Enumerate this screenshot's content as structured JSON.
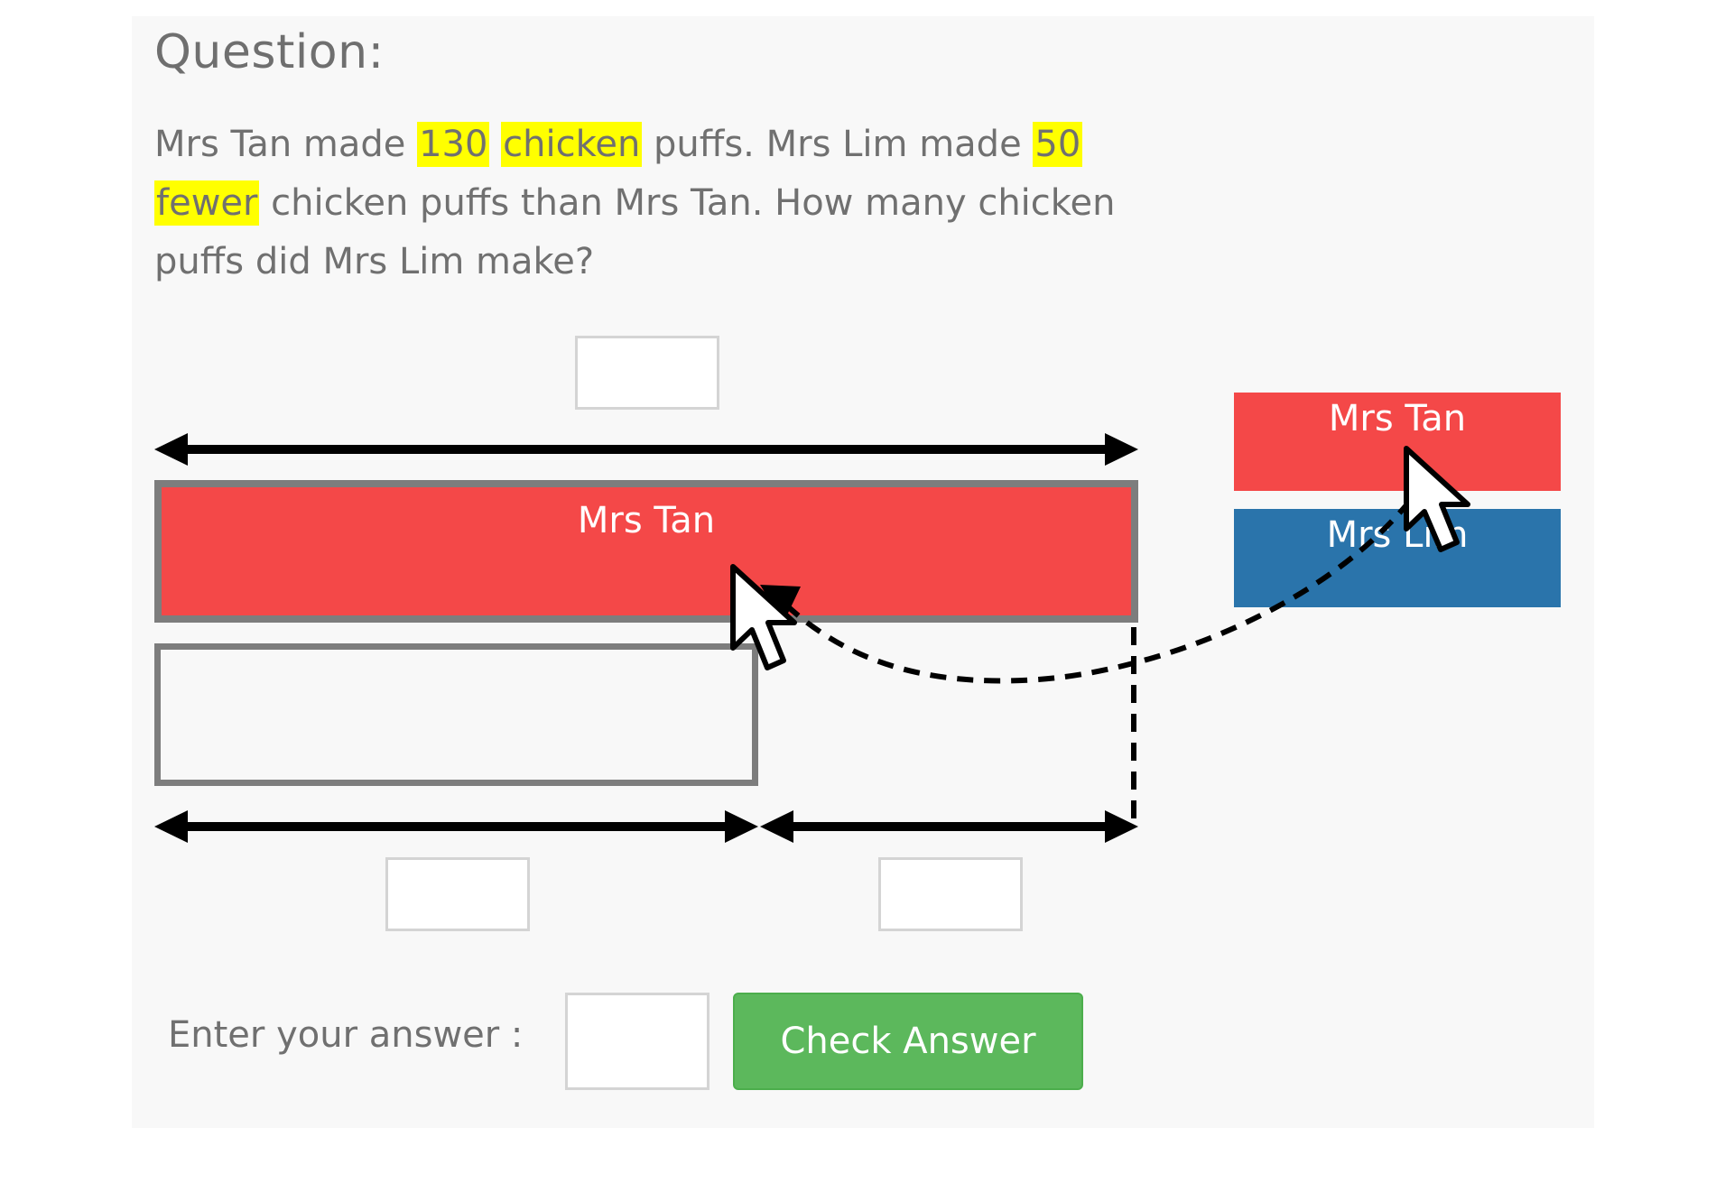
{
  "question": {
    "heading": "Question:",
    "parts": [
      {
        "text": "Mrs Tan made ",
        "highlight": false
      },
      {
        "text": "130",
        "highlight": true
      },
      {
        "text": " ",
        "highlight": false
      },
      {
        "text": "chicken",
        "highlight": true
      },
      {
        "text": " puffs. Mrs Lim made ",
        "highlight": false
      },
      {
        "text": "50",
        "highlight": true
      },
      {
        "text": " ",
        "highlight": false
      },
      {
        "text": "fewer",
        "highlight": true
      },
      {
        "text": " chicken puffs than Mrs Tan. How many chicken puffs did Mrs Lim make?",
        "highlight": false
      }
    ]
  },
  "model": {
    "top_bar_label": "Mrs Tan",
    "bottom_bar_label": ""
  },
  "draggables": {
    "tan_label": "Mrs Tan",
    "lim_label": "Mrs Lim"
  },
  "answer": {
    "label": "Enter your answer :",
    "value": "",
    "button_label": "Check Answer"
  },
  "colors": {
    "highlight": "#ffff00",
    "mrs_tan": "#f44848",
    "mrs_lim": "#2a74ab",
    "check_button": "#5cb85c"
  }
}
